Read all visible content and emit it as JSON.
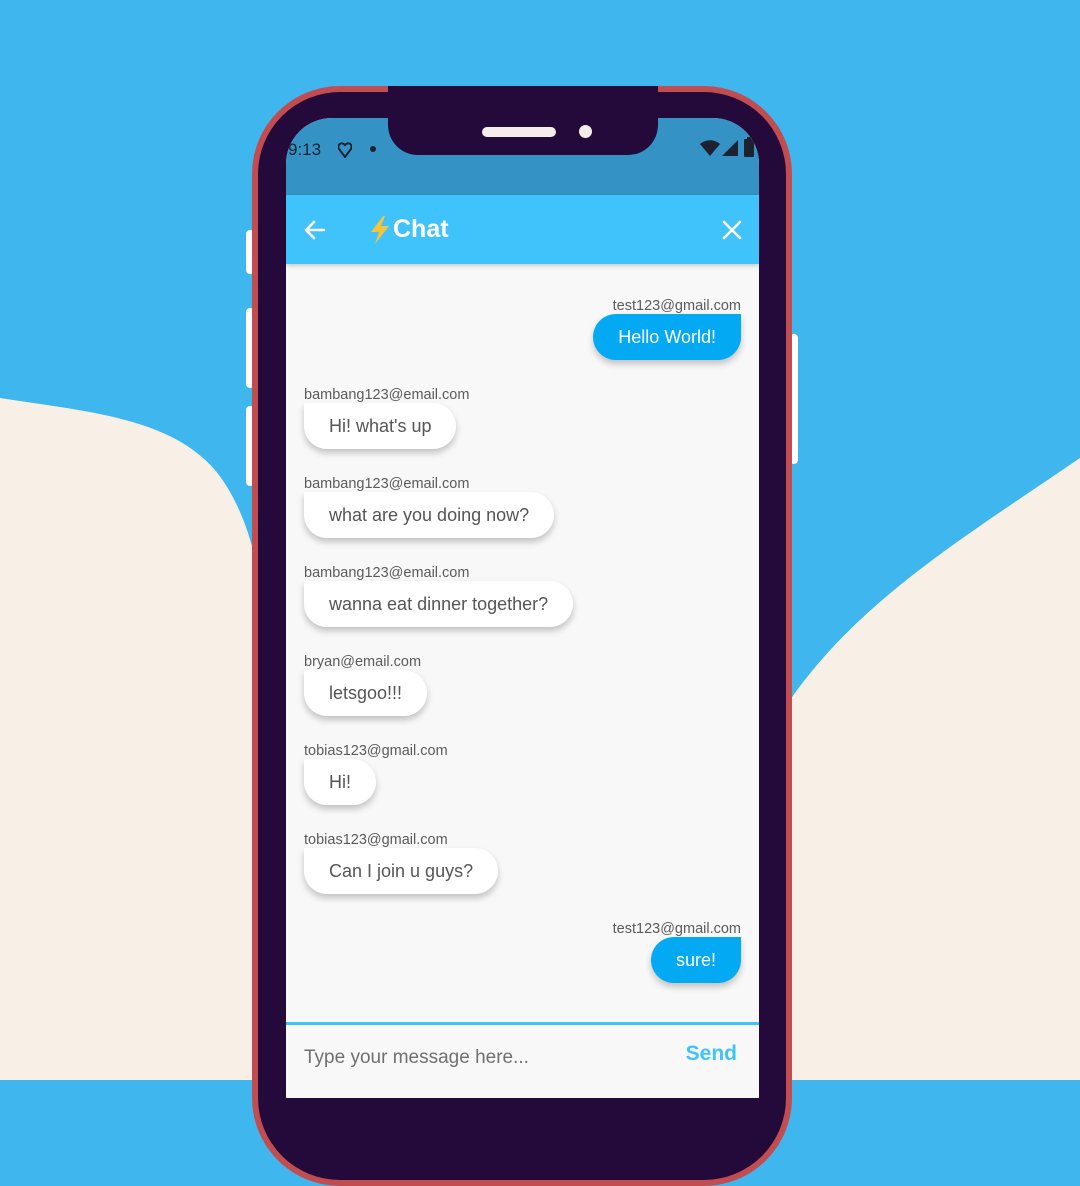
{
  "status_bar": {
    "time": "9:13",
    "icons": [
      "heart-monitor-icon",
      "dot-icon",
      "wifi-icon",
      "signal-icon",
      "battery-icon"
    ]
  },
  "app_bar": {
    "title": "Chat",
    "title_icon": "lightning-bolt-icon",
    "back_icon": "back-arrow-icon",
    "close_icon": "close-icon"
  },
  "messages": [
    {
      "sender": "test123@gmail.com",
      "text": "Hello World!",
      "mine": true
    },
    {
      "sender": "bambang123@email.com",
      "text": "Hi! what's up",
      "mine": false
    },
    {
      "sender": "bambang123@email.com",
      "text": "what are you doing now?",
      "mine": false
    },
    {
      "sender": "bambang123@email.com",
      "text": "wanna eat dinner together?",
      "mine": false
    },
    {
      "sender": "bryan@email.com",
      "text": "letsgoo!!!",
      "mine": false
    },
    {
      "sender": "tobias123@gmail.com",
      "text": "Hi!",
      "mine": false
    },
    {
      "sender": "tobias123@gmail.com",
      "text": "Can I join u guys?",
      "mine": false
    },
    {
      "sender": "test123@gmail.com",
      "text": "sure!",
      "mine": true
    }
  ],
  "composer": {
    "placeholder": "Type your message here...",
    "send_label": "Send"
  },
  "colors": {
    "background_blue": "#3fb7ee",
    "background_cream": "#f8f0e7",
    "phone_frame": "#c24d50",
    "app_bar": "#40c3fa",
    "my_bubble": "#04a9f4"
  }
}
